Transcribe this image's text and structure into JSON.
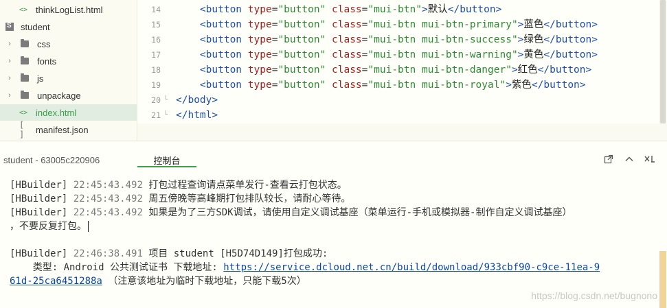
{
  "sidebar": {
    "items": [
      {
        "label": "thinkLogList.html",
        "icon": "code-icon",
        "chevron": "",
        "active": false
      },
      {
        "label": "student",
        "icon": "project-icon",
        "chevron": "",
        "active": false
      },
      {
        "label": "css",
        "icon": "folder-icon",
        "chevron": "›",
        "active": false
      },
      {
        "label": "fonts",
        "icon": "folder-icon",
        "chevron": "›",
        "active": false
      },
      {
        "label": "js",
        "icon": "folder-icon",
        "chevron": "›",
        "active": false
      },
      {
        "label": "unpackage",
        "icon": "folder-icon",
        "chevron": "›",
        "active": false
      },
      {
        "label": "index.html",
        "icon": "code-icon",
        "chevron": "",
        "active": true
      },
      {
        "label": "manifest.json",
        "icon": "json-icon",
        "chevron": "",
        "active": false
      }
    ]
  },
  "editor": {
    "line_numbers": [
      "14",
      "15",
      "16",
      "17",
      "18",
      "19",
      "20",
      "21"
    ],
    "lines": [
      {
        "tag": "button",
        "cls": "mui-btn",
        "text": "默认"
      },
      {
        "tag": "button",
        "cls": "mui-btn mui-btn-primary",
        "text": "蓝色"
      },
      {
        "tag": "button",
        "cls": "mui-btn mui-btn-success",
        "text": "绿色"
      },
      {
        "tag": "button",
        "cls": "mui-btn mui-btn-warning",
        "text": "黄色"
      },
      {
        "tag": "button",
        "cls": "mui-btn mui-btn-danger",
        "text": "红色"
      },
      {
        "tag": "button",
        "cls": "mui-btn mui-btn-royal",
        "text": "紫色"
      }
    ],
    "attr_type": "type",
    "attr_type_value": "\"button\"",
    "attr_class": "class",
    "close_body": "</body>",
    "close_html": "</html>"
  },
  "console": {
    "title": "student - 63005c220906",
    "tab_label": "控制台",
    "logs": [
      {
        "tag": "[HBuilder]",
        "time": "22:45:43.492",
        "msg": "打包过程查询请点菜单发行-查看云打包状态。"
      },
      {
        "tag": "[HBuilder]",
        "time": "22:45:43.492",
        "msg": "周五傍晚等高峰期打包排队较长，请耐心等待。"
      },
      {
        "tag": "[HBuilder]",
        "time": "22:45:43.492",
        "msg": "如果是为了三方SDK调试，请使用自定义调试基座（菜单运行-手机或模拟器-制作自定义调试基座）"
      },
      {
        "tag": "",
        "time": "",
        "msg": "，不要反复打包。"
      },
      {
        "tag": "[HBuilder]",
        "time": "22:46:38.491",
        "msg": "项目 student [H5D74D149]打包成功:"
      }
    ],
    "result_prefix": "    类型: Android 公共测试证书 下载地址: ",
    "download_url_part1": "https://service.dcloud.net.cn/build/download/933cbf90-c9ce-11ea-9",
    "download_url_part2": "61d-25ca6451288a",
    "result_note": " （注意该地址为临时下载地址，只能下载5次）",
    "watermark": "https://blog.csdn.net/bugnono"
  },
  "colors": {
    "accent_green": "#3aa04a",
    "tag_blue": "#1f4fa8",
    "attr_red": "#a52020",
    "string_green": "#2f8a35",
    "link_blue": "#0b47a8"
  }
}
